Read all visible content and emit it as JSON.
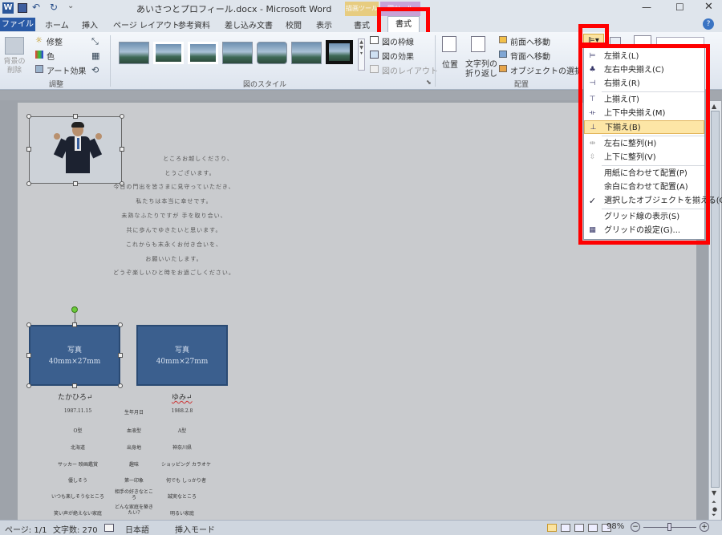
{
  "window": {
    "title": "あいさつとプロフィール.docx - Microsoft Word",
    "contextual_tab_group_1": "描画ツール",
    "contextual_tab_group_2": "図ツール"
  },
  "tabs": [
    {
      "label": "ファイル"
    },
    {
      "label": "ホーム"
    },
    {
      "label": "挿入"
    },
    {
      "label": "ページ レイアウト"
    },
    {
      "label": "参考資料"
    },
    {
      "label": "差し込み文書"
    },
    {
      "label": "校閲"
    },
    {
      "label": "表示"
    },
    {
      "label": "書式"
    },
    {
      "label": "書式"
    }
  ],
  "ribbon": {
    "adjust": {
      "remove_bg": "背景の削除",
      "corrections": "修整",
      "color": "色",
      "art_effects": "アート効果",
      "group_label": "調整"
    },
    "picture_styles": {
      "group_label": "図のスタイル",
      "border": "図の枠線",
      "effects": "図の効果",
      "layout": "図のレイアウト"
    },
    "arrange": {
      "position": "位置",
      "wrap_line1": "文字列の",
      "wrap_line2": "折り返し",
      "bring_forward": "前面へ移動",
      "send_backward": "背面へ移動",
      "selection_pane": "オブジェクトの選択と表示",
      "group_label": "配置"
    }
  },
  "align_menu": {
    "items": [
      {
        "label": "左揃え(L)",
        "icon": "align-left-icon",
        "enabled": true
      },
      {
        "label": "左右中央揃え(C)",
        "icon": "align-center-icon",
        "enabled": true
      },
      {
        "label": "右揃え(R)",
        "icon": "align-right-icon",
        "enabled": true
      },
      {
        "label": "上揃え(T)",
        "icon": "align-top-icon",
        "enabled": true
      },
      {
        "label": "上下中央揃え(M)",
        "icon": "align-middle-icon",
        "enabled": true
      },
      {
        "label": "下揃え(B)",
        "icon": "align-bottom-icon",
        "enabled": true,
        "highlighted": true
      },
      {
        "label": "左右に整列(H)",
        "icon": "distribute-horizontal-icon",
        "enabled": false
      },
      {
        "label": "上下に整列(V)",
        "icon": "distribute-vertical-icon",
        "enabled": false
      },
      {
        "label": "用紙に合わせて配置(P)",
        "enabled": true
      },
      {
        "label": "余白に合わせて配置(A)",
        "enabled": true
      },
      {
        "label": "選択したオブジェクトを揃える(O)",
        "icon": "checkmark-icon",
        "enabled": true,
        "checked": true
      },
      {
        "label": "グリッド線の表示(S)",
        "icon": "gridlines-icon",
        "enabled": true
      },
      {
        "label": "グリッドの設定(G)...",
        "icon": "grid-settings-icon",
        "enabled": true
      }
    ]
  },
  "document": {
    "greeting_lines": [
      "ところお越しくださり、",
      "とうございます。",
      "今日の門出を皆さまに見守っていただき、",
      "私たちは本当に幸せです。",
      "未熟なふたりですが 手を取り合い、",
      "共に歩んでゆきたいと思います。",
      "これからも末永くお付き合いを、",
      "お願いいたします。",
      "どうぞ楽しいひと時をお過ごしください。"
    ],
    "photo_box_1": {
      "line1": "写真",
      "line2": "40mm×27mm"
    },
    "photo_box_2": {
      "line1": "写真",
      "line2": "40mm×27mm"
    },
    "groom_name": "たかひろ↵",
    "bride_name": "ゆみ↵",
    "profile_rows": [
      {
        "left": "1987.11.15",
        "mid": "生年月日",
        "right": "1988.2.8"
      },
      {
        "left": "O型",
        "mid": "血液型",
        "right": "A型"
      },
      {
        "left": "北海道",
        "mid": "出身地",
        "right": "神奈川県"
      },
      {
        "left": "サッカー 映画鑑賞",
        "mid": "趣味",
        "right": "ショッピング カラオケ"
      },
      {
        "left": "優しそう",
        "mid": "第一印象",
        "right": "何でも しっかり者"
      },
      {
        "left": "いつも楽しそうなところ",
        "mid": "相手の好きなところ",
        "right": "誠実なところ"
      },
      {
        "left": "笑い声が絶えない家庭",
        "mid": "どんな家庭を築きたい?",
        "right": "明るい家庭"
      }
    ]
  },
  "status": {
    "page": "ページ: 1/1",
    "words": "文字数: 270",
    "language": "日本語",
    "mode": "挿入モード",
    "zoom": "98%"
  }
}
